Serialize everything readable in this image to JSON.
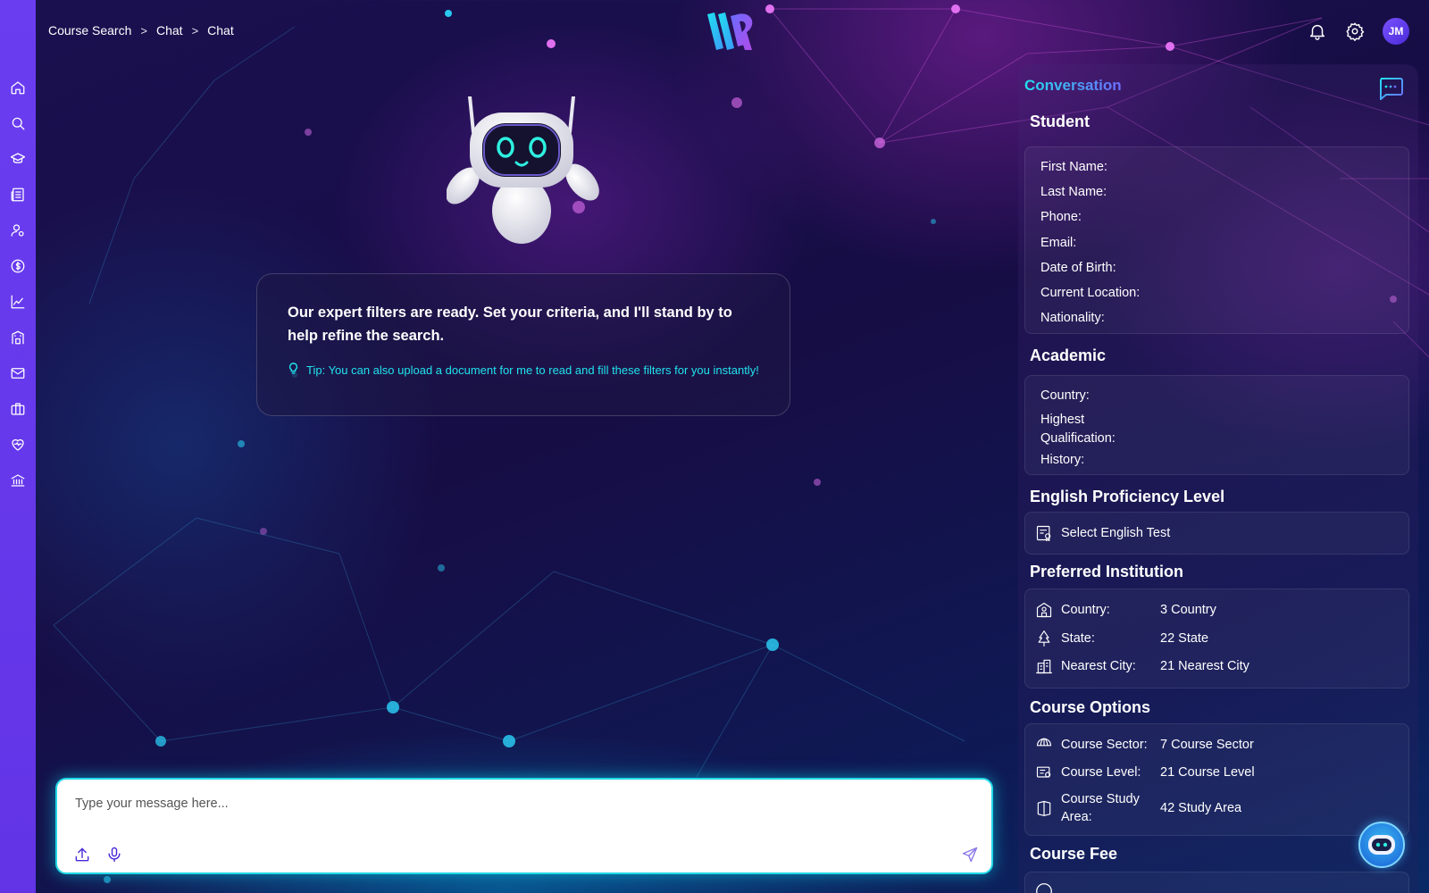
{
  "breadcrumb": {
    "items": [
      "Course Search",
      "Chat",
      "Chat"
    ],
    "separator": ">"
  },
  "header": {
    "avatar_initials": "JM",
    "icons": [
      "bell-icon",
      "gear-icon"
    ]
  },
  "sidebar": {
    "items": [
      {
        "name": "home",
        "icon": "home-icon"
      },
      {
        "name": "search",
        "icon": "search-icon"
      },
      {
        "name": "courses",
        "icon": "graduation-cap-icon"
      },
      {
        "name": "news",
        "icon": "newspaper-icon"
      },
      {
        "name": "users",
        "icon": "user-settings-icon"
      },
      {
        "name": "finance",
        "icon": "dollar-icon"
      },
      {
        "name": "analytics",
        "icon": "chart-icon"
      },
      {
        "name": "institutions",
        "icon": "building-icon"
      },
      {
        "name": "mail",
        "icon": "mail-icon"
      },
      {
        "name": "jobs",
        "icon": "briefcase-icon"
      },
      {
        "name": "health",
        "icon": "heart-icon"
      },
      {
        "name": "bank",
        "icon": "bank-icon"
      }
    ]
  },
  "chat": {
    "message": "Our expert filters are ready. Set your criteria, and I'll stand by to help refine the search.",
    "tip": "Tip: You can also upload a document for me to read and fill these filters for you instantly!",
    "input_placeholder": "Type your message here..."
  },
  "panel": {
    "title": "Conversation",
    "student": {
      "title": "Student",
      "fields": [
        "First Name:",
        "Last Name:",
        "Phone:",
        "Email:",
        "Date of Birth:",
        "Current Location:",
        "Nationality:"
      ]
    },
    "academic": {
      "title": "Academic",
      "country": "Country:",
      "highest_1": "Highest",
      "highest_2": "Qualification:",
      "history": "History:"
    },
    "english": {
      "title": "English Proficiency Level",
      "select": "Select English Test"
    },
    "institution": {
      "title": "Preferred Institution",
      "rows": [
        {
          "label": "Country:",
          "value": "3 Country",
          "icon": "school-icon"
        },
        {
          "label": "State:",
          "value": "22 State",
          "icon": "tree-icon"
        },
        {
          "label": "Nearest City:",
          "value": "21 Nearest City",
          "icon": "city-icon"
        }
      ]
    },
    "course_options": {
      "title": "Course Options",
      "rows": [
        {
          "label": "Course Sector:",
          "value": "7 Course Sector",
          "icon": "sector-icon"
        },
        {
          "label": "Course Level:",
          "value": "21 Course Level",
          "icon": "certificate-icon"
        },
        {
          "label_1": "Course Study",
          "label_2": "Area:",
          "value": "42 Study Area",
          "icon": "book-icon"
        }
      ]
    },
    "fee": {
      "title": "Course Fee"
    }
  },
  "colors": {
    "sidebar": "#6a3df0",
    "accent_cyan": "#21e3ee",
    "accent_purple": "#4a2ad8"
  }
}
